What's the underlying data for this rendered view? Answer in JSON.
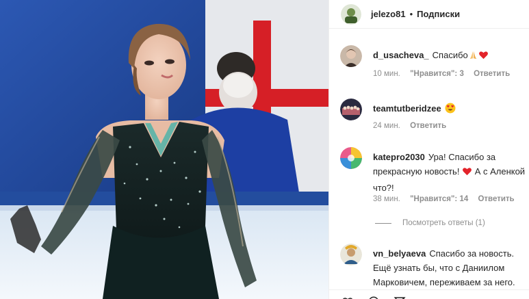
{
  "post": {
    "author": {
      "username": "jelezo81",
      "follow_label": "Подписки",
      "separator": "•"
    },
    "comments": [
      {
        "username": "d_usacheva_",
        "text": "Спасибо",
        "emoji": [
          "praying-hands",
          "red-heart"
        ],
        "time": "10 мин.",
        "likes": "\"Нравится\": 3",
        "reply_label": "Ответить"
      },
      {
        "username": "teamtutberidzee",
        "text": "",
        "emoji": [
          "heart-eyes"
        ],
        "time": "24 мин.",
        "reply_label": "Ответить"
      },
      {
        "username": "katepro2030",
        "text_before": "Ура! Спасибо за прекрасную новость!",
        "text_after": "А с Аленкой что?!",
        "emoji": [
          "red-heart"
        ],
        "time": "38 мин.",
        "likes": "\"Нравится\": 14",
        "reply_label": "Ответить",
        "view_replies_label": "Посмотреть ответы (1)"
      },
      {
        "username": "vn_belyaeva",
        "text": "Спасибо за новость. Ещё узнать бы, что с Даниилом Марковичем, переживаем за него."
      }
    ]
  },
  "colors": {
    "heart": "#ed4956",
    "muted": "#8e8e8e",
    "text": "#262626",
    "divider": "#efefef",
    "rink_blue": "#1d3f86"
  }
}
